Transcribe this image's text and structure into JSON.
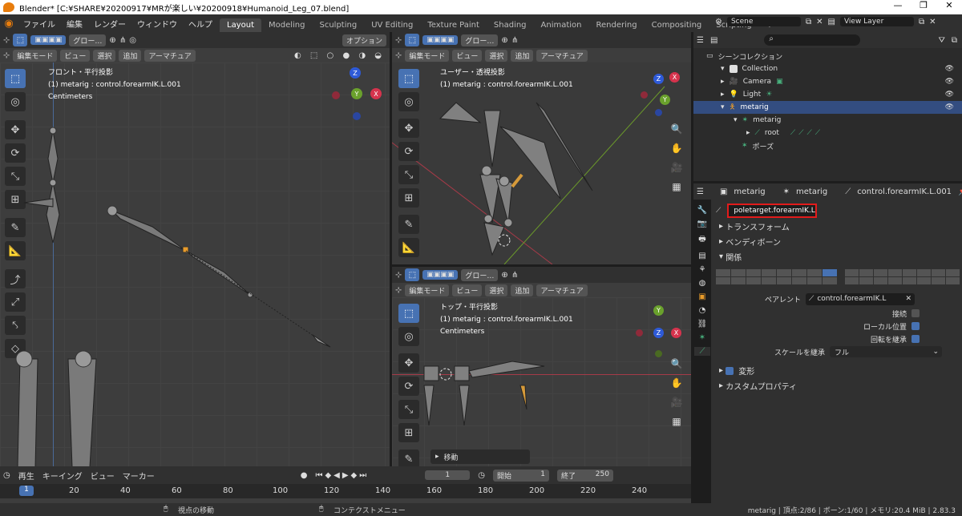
{
  "window": {
    "title": "Blender* [C:¥SHARE¥20200917¥MRが楽しい¥20200918¥Humanoid_Leg_07.blend]",
    "controls": [
      "—",
      "❐",
      "✕"
    ]
  },
  "menu": [
    "ファイル",
    "編集",
    "レンダー",
    "ウィンドウ",
    "ヘルプ"
  ],
  "workspaces": [
    "Layout",
    "Modeling",
    "Sculpting",
    "UV Editing",
    "Texture Paint",
    "Shading",
    "Animation",
    "Rendering",
    "Compositing",
    "Scripting",
    "+"
  ],
  "scene": {
    "label": "Scene",
    "view_layer": "View Layer"
  },
  "viewport_header": {
    "transform": "グロー…",
    "options": "オプション",
    "mode": "編集モード",
    "view": "ビュー",
    "select": "選択",
    "add": "追加",
    "armature": "アーマチュア"
  },
  "front": {
    "title": "フロント・平行投影",
    "info": "(1) metarig : control.forearmIK.L.001",
    "units": "Centimeters"
  },
  "user": {
    "title": "ユーザー・透視投影",
    "info": "(1) metarig : control.forearmIK.L.001"
  },
  "top": {
    "title": "トップ・平行投影",
    "info": "(1) metarig : control.forearmIK.L.001",
    "units": "Centimeters",
    "operator": "移動"
  },
  "axes": {
    "x": "X",
    "y": "Y",
    "z": "Z"
  },
  "outliner": {
    "root": "シーンコレクション",
    "items": [
      {
        "label": "Collection",
        "indent": 1
      },
      {
        "label": "Camera",
        "indent": 2
      },
      {
        "label": "Light",
        "indent": 2
      },
      {
        "label": "metarig",
        "indent": 2,
        "selected": true
      },
      {
        "label": "metarig",
        "indent": 3
      },
      {
        "label": "root",
        "indent": 4
      },
      {
        "label": "ポーズ",
        "indent": 3
      }
    ]
  },
  "properties": {
    "breadcrumb": [
      "metarig",
      "metarig",
      "control.forearmIK.L.001"
    ],
    "bone_name": "poletarget.forearmIK.L",
    "sections": {
      "transform": "トランスフォーム",
      "bendy": "ベンディボーン",
      "relations": "関係",
      "deform": "変形",
      "custom": "カスタムプロパティ"
    },
    "parent_label": "ペアレント",
    "parent_value": "control.forearmIK.L",
    "connected": "接続",
    "local_location": "ローカル位置",
    "inherit_rotation": "回転を継承",
    "inherit_scale_label": "スケールを継承",
    "inherit_scale_value": "フル"
  },
  "timeline": {
    "playback": "再生",
    "keying": "キーイング",
    "view": "ビュー",
    "marker": "マーカー",
    "current": "1",
    "start_label": "開始",
    "start": "1",
    "end_label": "終了",
    "end": "250",
    "ticks": [
      "20",
      "40",
      "60",
      "80",
      "100",
      "120",
      "140",
      "160",
      "180",
      "200",
      "220",
      "240"
    ],
    "cursor": "1"
  },
  "status": {
    "left": "視点の移動",
    "middle": "コンテクストメニュー",
    "right": "metarig | 頂点:2/86 | ボーン:1/60 | メモリ:20.4 MiB | 2.83.3"
  }
}
